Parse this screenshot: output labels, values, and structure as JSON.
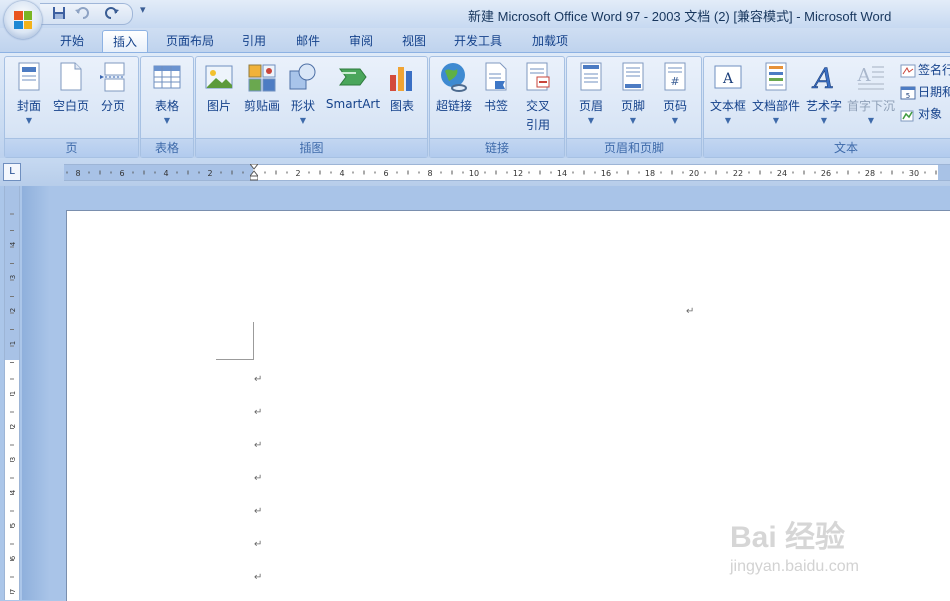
{
  "window": {
    "title": "新建 Microsoft Office Word 97 - 2003 文档 (2) [兼容模式] - Microsoft Word",
    "office_button_icon": "office-logo-icon",
    "qat": {
      "save_icon": "save-icon",
      "undo_icon": "undo-icon",
      "redo_icon": "redo-icon",
      "more_label": "▾"
    }
  },
  "tabs": [
    {
      "label": "开始"
    },
    {
      "label": "插入",
      "active": true
    },
    {
      "label": "页面布局"
    },
    {
      "label": "引用"
    },
    {
      "label": "邮件"
    },
    {
      "label": "审阅"
    },
    {
      "label": "视图"
    },
    {
      "label": "开发工具"
    },
    {
      "label": "加载项"
    }
  ],
  "ribbon": {
    "groups": {
      "pages": {
        "label": "页",
        "buttons": [
          "封面",
          "空白页",
          "分页"
        ]
      },
      "tables": {
        "label": "表格",
        "buttons": [
          "表格"
        ]
      },
      "illustrations": {
        "label": "插图",
        "buttons": [
          "图片",
          "剪贴画",
          "形状",
          "SmartArt",
          "图表"
        ]
      },
      "links": {
        "label": "链接",
        "buttons": [
          "超链接",
          "书签",
          "交叉",
          "引用"
        ]
      },
      "header_footer": {
        "label": "页眉和页脚",
        "buttons": [
          "页眉",
          "页脚",
          "页码"
        ]
      },
      "text": {
        "label": "文本",
        "buttons": [
          "文本框",
          "文档部件",
          "艺术字",
          "首字下沉"
        ],
        "small_buttons": [
          "签名行",
          "日期和",
          "对象"
        ]
      }
    }
  },
  "ruler": {
    "tab_selector": "L",
    "left_ticks": [
      "8",
      "6",
      "4",
      "2"
    ],
    "right_ticks": [
      "2",
      "4",
      "6",
      "8",
      "10",
      "12",
      "14",
      "16",
      "18",
      "20",
      "22",
      "24",
      "26",
      "28",
      "30"
    ],
    "vertical_top_ticks": [
      "4",
      "3",
      "2",
      "1"
    ],
    "vertical_ticks": [
      "1",
      "2",
      "3",
      "4",
      "5",
      "6",
      "7"
    ]
  },
  "document": {
    "paragraph_mark": "↵",
    "paragraph_count": 7
  },
  "watermark": {
    "text": "Bai 经验",
    "subtext": "jingyan.baidu.com"
  }
}
